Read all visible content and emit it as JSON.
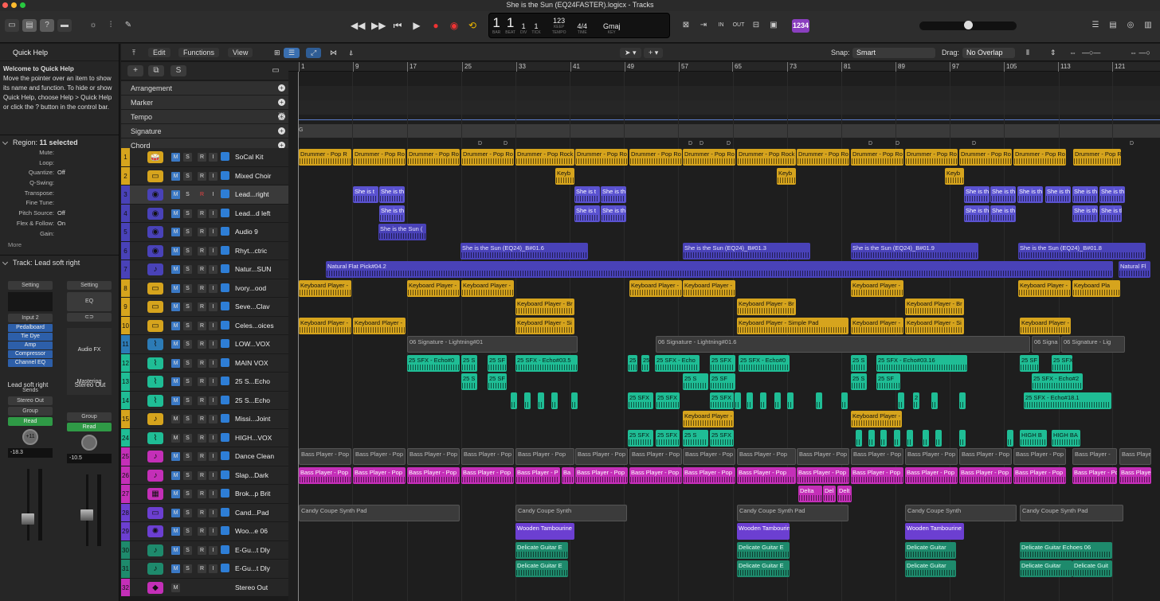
{
  "window": {
    "title": "She is the Sun (EQ24FASTER).logicx - Tracks"
  },
  "lcd": {
    "bar": "1",
    "beat": "1",
    "div": "1",
    "tick": "1",
    "bar_lab": "BAR",
    "beat_lab": "BEAT",
    "div_lab": "DIV",
    "tick_lab": "TICK",
    "tempo": "123",
    "tempo_mode": "KEEP",
    "tempo_lab": "TEMPO",
    "sig": "4/4",
    "sig_lab": "TIME",
    "key": "Gmaj",
    "key_lab": "KEY",
    "count": "1234"
  },
  "inspector": {
    "quick_help_title": "Quick Help",
    "quick_help_head": "Welcome to Quick Help",
    "quick_help_body": "Move the pointer over an item to show its name and function. To hide or show Quick Help, choose Help > Quick Help or click the ? button in the control bar.",
    "region_title": "Region:",
    "region_count": "11 selected",
    "params": [
      {
        "label": "Mute:",
        "value": ""
      },
      {
        "label": "Loop:",
        "value": ""
      },
      {
        "label": "Quantize:",
        "value": "Off"
      },
      {
        "label": "Q-Swing:",
        "value": ""
      },
      {
        "label": "Transpose:",
        "value": ""
      },
      {
        "label": "Fine Tune:",
        "value": ""
      },
      {
        "label": "Pitch Source:",
        "value": "Off"
      },
      {
        "label": "Flex & Follow:",
        "value": "On"
      },
      {
        "label": "Gain:",
        "value": ""
      }
    ],
    "more": "More",
    "track_title": "Track:",
    "track_name": "Lead soft right",
    "strip1": {
      "setting": "Setting",
      "input": "Input 2",
      "plugins": [
        "Pedalboard",
        "Tie Dye",
        "Amp",
        "Compressor",
        "Channel EQ"
      ],
      "sends": "Sends",
      "out": "Stereo Out",
      "group": "Group",
      "read": "Read",
      "pan": "+11",
      "vol": "-18.3",
      "name": "Lead soft right",
      "m": "M",
      "s": "S",
      "r": "R",
      "i": "I"
    },
    "strip2": {
      "setting": "Setting",
      "eq": "EQ",
      "audiofx": "Audio FX",
      "mastering": "Mastering",
      "group": "Group",
      "read": "Read",
      "vol": "-10.5",
      "name": "Stereo Out",
      "m": "M",
      "bnc": "Bnc"
    }
  },
  "header": {
    "edit": "Edit",
    "functions": "Functions",
    "view": "View",
    "snap_label": "Snap:",
    "snap": "Smart",
    "drag_label": "Drag:",
    "drag": "No Overlap"
  },
  "globals": [
    "Arrangement",
    "Marker",
    "Tempo",
    "Signature",
    "Chord"
  ],
  "tempo_vals": [
    "150",
    "110"
  ],
  "ruler": [
    "1",
    "9",
    "17",
    "25",
    "33",
    "41",
    "49",
    "57",
    "65",
    "73",
    "81",
    "89",
    "97",
    "105",
    "113",
    "121"
  ],
  "tracks": [
    {
      "num": "1",
      "name": "SoCal Kit",
      "color": "#d6a41d"
    },
    {
      "num": "2",
      "name": "Mixed Choir",
      "color": "#d6a41d"
    },
    {
      "num": "3",
      "name": "Lead...right",
      "color": "#4942b8"
    },
    {
      "num": "4",
      "name": "Lead...d left",
      "color": "#4942b8"
    },
    {
      "num": "5",
      "name": "Audio 9",
      "color": "#4942b8"
    },
    {
      "num": "6",
      "name": "Rhyt...ctric",
      "color": "#4942b8"
    },
    {
      "num": "7",
      "name": "Natur...SUN",
      "color": "#4942b8"
    },
    {
      "num": "8",
      "name": "Ivory...ood",
      "color": "#d6a41d"
    },
    {
      "num": "9",
      "name": "Seve...Clav",
      "color": "#d6a41d"
    },
    {
      "num": "10",
      "name": "Celes...oices",
      "color": "#d6a41d"
    },
    {
      "num": "11",
      "name": "LOW...VOX",
      "color": "#2c7bb6"
    },
    {
      "num": "12",
      "name": "MAIN VOX",
      "color": "#1fbd95"
    },
    {
      "num": "13",
      "name": "25 S...Echo",
      "color": "#1fbd95"
    },
    {
      "num": "14",
      "name": "25 S...Echo",
      "color": "#1fbd95"
    },
    {
      "num": "15",
      "name": "Missi...Joint",
      "color": "#d6a41d"
    },
    {
      "num": "24",
      "name": "HIGH...VOX",
      "color": "#1fbd95"
    },
    {
      "num": "25",
      "name": "Dance Clean",
      "color": "#c42fb8"
    },
    {
      "num": "26",
      "name": "Slap...Dark",
      "color": "#c42fb8"
    },
    {
      "num": "27",
      "name": "Brok...p Brit",
      "color": "#c42fb8"
    },
    {
      "num": "28",
      "name": "Cand...Pad",
      "color": "#6c3fd1"
    },
    {
      "num": "29",
      "name": "Woo...e 06",
      "color": "#6c3fd1"
    },
    {
      "num": "30",
      "name": "E-Gu...t Dly",
      "color": "#1e8a6c"
    },
    {
      "num": "31",
      "name": "E-Gu...t Dly",
      "color": "#1e8a6c"
    },
    {
      "num": "32",
      "name": "Stereo Out",
      "color": "#c42fb8"
    }
  ],
  "regions": {
    "drum": "Drummer - Pop R",
    "drum2": "Drummer - Pop Ro",
    "drum3": "Drummer - Pop Rock",
    "keyb": "Keyb",
    "lead": "She is t",
    "lead2": "She is th",
    "sun5": "She is the Sun (",
    "sun1": "She is the Sun (EQ24)_B#01.6",
    "sun2": "She is the Sun (EQ24)_B#01.3",
    "sun3": "She is the Sun (EQ24)_B#01.9",
    "sun4": "She is the Sun (EQ24)_B#01.8",
    "nat": "Natural Flat Pick#04.2",
    "nat2": "Natural Fl",
    "kp": "Keyboard Player -",
    "kpb": "Keyboard Player - Br",
    "kps": "Keyboard Player - Si",
    "kpsp": "Keyboard Player - Simple Pad",
    "kppla": "Keyboard Pla",
    "sig1": "06 Signature - Lightning#01",
    "sig2": "06 Signature - Lightning#01.6",
    "sig3": "06 Signa",
    "sig4": "06 Signature - Lig",
    "sfx1": "25 SFX - Echo#0",
    "sfx2": "25 SFX - Echo#03.5",
    "sfx3": "25 SFX - Echo",
    "sfx4": "25 SFX - Echo#03.16",
    "sfx5": "25 SFX - Echo#2",
    "sfx6": "25 SFX - Echo#18.1",
    "sfx": "25 SFX",
    "sfxs": "25 S",
    "sfxf": "25 SF",
    "sfx2s": "25",
    "num2": "2",
    "highb": "HIGH B",
    "highba": "HIGH BA",
    "bass": "Bass Player - Pop",
    "bass2": "Bass Player -",
    "bass3": "Bass Playe",
    "bassp": "Bass Player - P",
    "ba": "Ba",
    "delta": "Delta",
    "del": "Del",
    "delt": "Delt",
    "candy": "Candy Coupe Synth Pad",
    "candy2": "Candy Coupe Synth",
    "wood": "Wooden Tambourine",
    "guit": "Delicate Guitar E",
    "guit2": "Delicate Guitar",
    "guit3": "Delicate Guitar Echoes 06",
    "guit4": "Delicate Guit",
    "d": "D",
    "g": "G"
  },
  "colors": {
    "accent": "#2e7ed6",
    "read": "#2f9a46",
    "count": "#8a3fbf"
  }
}
